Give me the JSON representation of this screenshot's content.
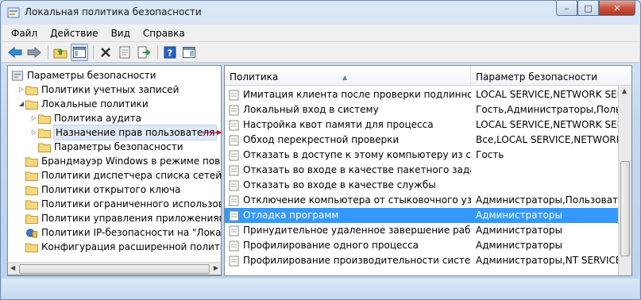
{
  "window": {
    "title": "Локальная политика безопасности",
    "controls": {
      "minimize": "–",
      "maximize": "□",
      "close": "✕"
    }
  },
  "menu": [
    "Файл",
    "Действие",
    "Вид",
    "Справка"
  ],
  "toolbar": {
    "buttons": [
      "back-icon",
      "forward-icon",
      "up-folder-icon",
      "show-hide-tree-icon",
      "delete-icon",
      "properties-icon",
      "export-icon",
      "help-icon",
      "console-view-icon"
    ]
  },
  "tree": [
    {
      "label": "Параметры безопасности",
      "level": 0,
      "expanded": true
    },
    {
      "label": "Политики учетных записей",
      "level": 1,
      "expanded": false
    },
    {
      "label": "Локальные политики",
      "level": 1,
      "expanded": true
    },
    {
      "label": "Политика аудита",
      "level": 2,
      "expanded": false
    },
    {
      "label": "Назначение прав пользователя",
      "level": 2,
      "expanded": false,
      "selected": true
    },
    {
      "label": "Параметры безопасности",
      "level": 2
    },
    {
      "label": "Брандмауэр Windows в режиме повышенной",
      "level": 1
    },
    {
      "label": "Политики диспетчера списка сетей",
      "level": 1
    },
    {
      "label": "Политики открытого ключа",
      "level": 1
    },
    {
      "label": "Политики ограниченного использования",
      "level": 1
    },
    {
      "label": "Политики управления приложениями",
      "level": 1
    },
    {
      "label": "Политики IP-безопасности на \"Локальный",
      "level": 1
    },
    {
      "label": "Конфигурация расширенной политики",
      "level": 1
    }
  ],
  "table": {
    "columns": [
      "Политика",
      "Параметр безопасности"
    ],
    "rows": [
      {
        "policy": "Имитация клиента после проверки подлинности",
        "value": "LOCAL SERVICE,NETWORK SERVICE"
      },
      {
        "policy": "Локальный вход в систему",
        "value": "Гость,Администраторы,Пользователи"
      },
      {
        "policy": "Настройка квот памяти для процесса",
        "value": "LOCAL SERVICE,NETWORK SERVICE"
      },
      {
        "policy": "Обход перекрестной проверки",
        "value": "Все,LOCAL SERVICE,NETWORK SERVICE"
      },
      {
        "policy": "Отказать в доступе к этому компьютеру из сети",
        "value": "Гость"
      },
      {
        "policy": "Отказать во входе в качестве пакетного задания",
        "value": ""
      },
      {
        "policy": "Отказать во входе в качестве службы",
        "value": ""
      },
      {
        "policy": "Отключение компьютера от стыковочного узла",
        "value": "Администраторы,Пользователи"
      },
      {
        "policy": "Отладка программ",
        "value": "Администраторы",
        "selected": true
      },
      {
        "policy": "Принудительное удаленное завершение работы",
        "value": "Администраторы"
      },
      {
        "policy": "Профилирование одного процесса",
        "value": "Администраторы"
      },
      {
        "policy": "Профилирование производительности системы",
        "value": "Администраторы,NT SERVICE\\WdiServiceHost"
      }
    ]
  },
  "colors": {
    "selection": "#3399ff",
    "pointer_arrow": "#c0143c"
  }
}
